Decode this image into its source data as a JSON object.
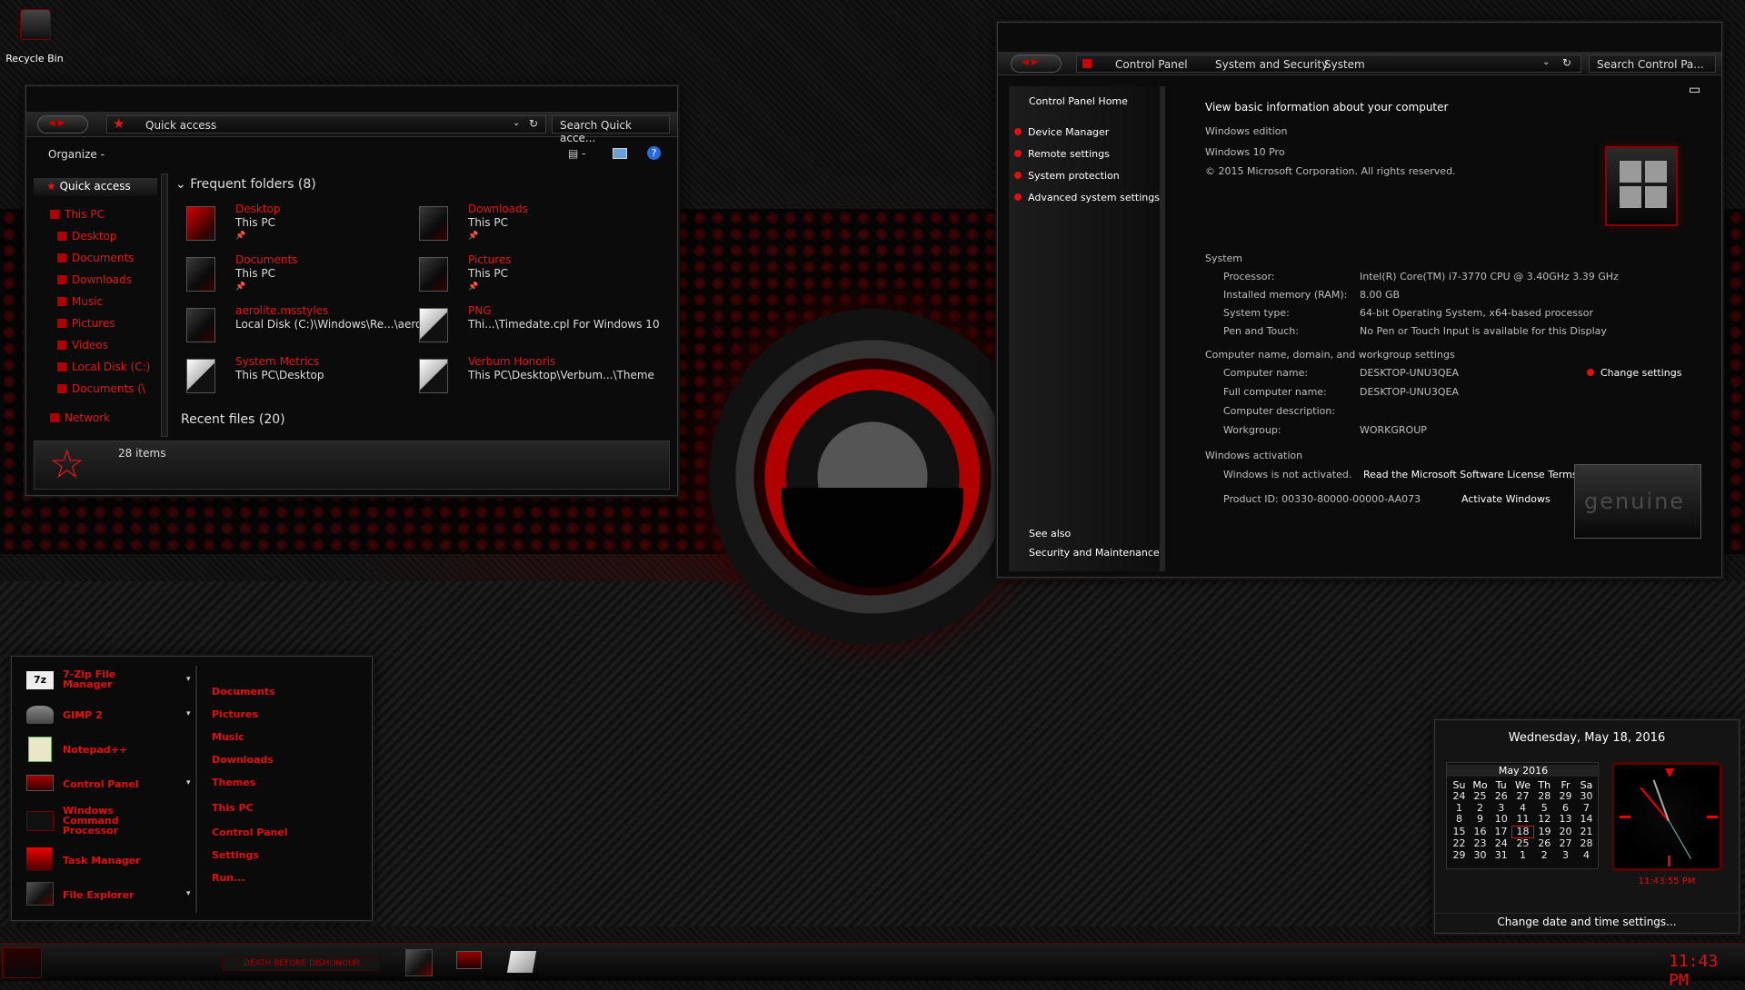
{
  "desktop": {
    "recycle_bin_label": "Recycle Bin"
  },
  "explorer": {
    "location": "Quick access",
    "search_placeholder": "Search Quick acce...",
    "organize_label": "Organize -",
    "nav": [
      {
        "label": "Quick access"
      },
      {
        "label": "This PC"
      },
      {
        "label": "Desktop"
      },
      {
        "label": "Documents"
      },
      {
        "label": "Downloads"
      },
      {
        "label": "Music"
      },
      {
        "label": "Pictures"
      },
      {
        "label": "Videos"
      },
      {
        "label": "Local Disk (C:)"
      },
      {
        "label": "Documents (\\"
      },
      {
        "label": "Network"
      }
    ],
    "frequent_header": "Frequent folders (8)",
    "folders": [
      {
        "name": "Desktop",
        "path": "This PC",
        "pinned": "📌"
      },
      {
        "name": "Downloads",
        "path": "This PC",
        "pinned": "📌"
      },
      {
        "name": "Documents",
        "path": "This PC",
        "pinned": "📌"
      },
      {
        "name": "Pictures",
        "path": "This PC",
        "pinned": "📌"
      },
      {
        "name": "aerolite.msstyles",
        "path": "Local Disk (C:)\\Windows\\Re...\\aero",
        "pinned": ""
      },
      {
        "name": "PNG",
        "path": "Thi...\\Timedate.cpl For Windows 10",
        "pinned": ""
      },
      {
        "name": "System Metrics",
        "path": "This PC\\Desktop",
        "pinned": ""
      },
      {
        "name": "Verbum Honoris",
        "path": "This PC\\Desktop\\Verbum...\\Theme",
        "pinned": ""
      }
    ],
    "recent_header": "Recent files (20)",
    "status": "28 items"
  },
  "control_panel": {
    "breadcrumb": [
      "Control Panel",
      "System and Security",
      "System"
    ],
    "search_placeholder": "Search Control Pa...",
    "side_home": "Control Panel Home",
    "side_links": [
      "Device Manager",
      "Remote settings",
      "System protection",
      "Advanced system settings"
    ],
    "see_also": "See also",
    "see_also_link": "Security and Maintenance",
    "heading": "View basic information about your computer",
    "edition_header": "Windows edition",
    "edition": "Windows 10 Pro",
    "copyright": "© 2015 Microsoft Corporation. All rights reserved.",
    "system_header": "System",
    "system_rows": [
      {
        "k": "Processor:",
        "v": "Intel(R) Core(TM) i7-3770 CPU @ 3.40GHz   3.39 GHz"
      },
      {
        "k": "Installed memory (RAM):",
        "v": "8.00 GB"
      },
      {
        "k": "System type:",
        "v": "64-bit Operating System, x64-based processor"
      },
      {
        "k": "Pen and Touch:",
        "v": "No Pen or Touch Input is available for this Display"
      }
    ],
    "name_header": "Computer name, domain, and workgroup settings",
    "name_rows": [
      {
        "k": "Computer name:",
        "v": "DESKTOP-UNU3QEA"
      },
      {
        "k": "Full computer name:",
        "v": "DESKTOP-UNU3QEA"
      },
      {
        "k": "Computer description:",
        "v": ""
      },
      {
        "k": "Workgroup:",
        "v": "WORKGROUP"
      }
    ],
    "change_settings": "Change settings",
    "activation_header": "Windows activation",
    "activation_status": "Windows is not activated.",
    "license_link": "Read the Microsoft Software License Terms",
    "product_id": "Product ID: 00330-80000-00000-AA073",
    "activate_link": "Activate Windows",
    "genuine": "genuine"
  },
  "start_menu": {
    "apps": [
      {
        "label": "7-Zip File Manager"
      },
      {
        "label": "GIMP 2"
      },
      {
        "label": "Notepad++"
      },
      {
        "label": "Control Panel"
      },
      {
        "label": "Windows Command Processor"
      },
      {
        "label": "Task Manager"
      },
      {
        "label": "File Explorer"
      }
    ],
    "places": [
      "Documents",
      "Pictures",
      "Music",
      "Downloads",
      "Themes",
      "This PC",
      "Control Panel",
      "Settings",
      "Run..."
    ]
  },
  "clock_flyout": {
    "date_long": "Wednesday, May 18, 2016",
    "month": "May 2016",
    "weekdays": [
      "Su",
      "Mo",
      "Tu",
      "We",
      "Th",
      "Fr",
      "Sa"
    ],
    "weeks": [
      [
        "24",
        "25",
        "26",
        "27",
        "28",
        "29",
        "30"
      ],
      [
        "1",
        "2",
        "3",
        "4",
        "5",
        "6",
        "7"
      ],
      [
        "8",
        "9",
        "10",
        "11",
        "12",
        "13",
        "14"
      ],
      [
        "15",
        "16",
        "17",
        "18",
        "19",
        "20",
        "21"
      ],
      [
        "22",
        "23",
        "24",
        "25",
        "26",
        "27",
        "28"
      ],
      [
        "29",
        "30",
        "31",
        "1",
        "2",
        "3",
        "4"
      ]
    ],
    "today": "18",
    "digital_time": "11:43:55 PM",
    "change_link": "Change date and time settings..."
  },
  "taskbar": {
    "pinned_label": "DEATH BEFORE DISHONOUR",
    "clock": "11:43 PM"
  },
  "colors": {
    "accent": "#e01818",
    "background": "#050505"
  }
}
